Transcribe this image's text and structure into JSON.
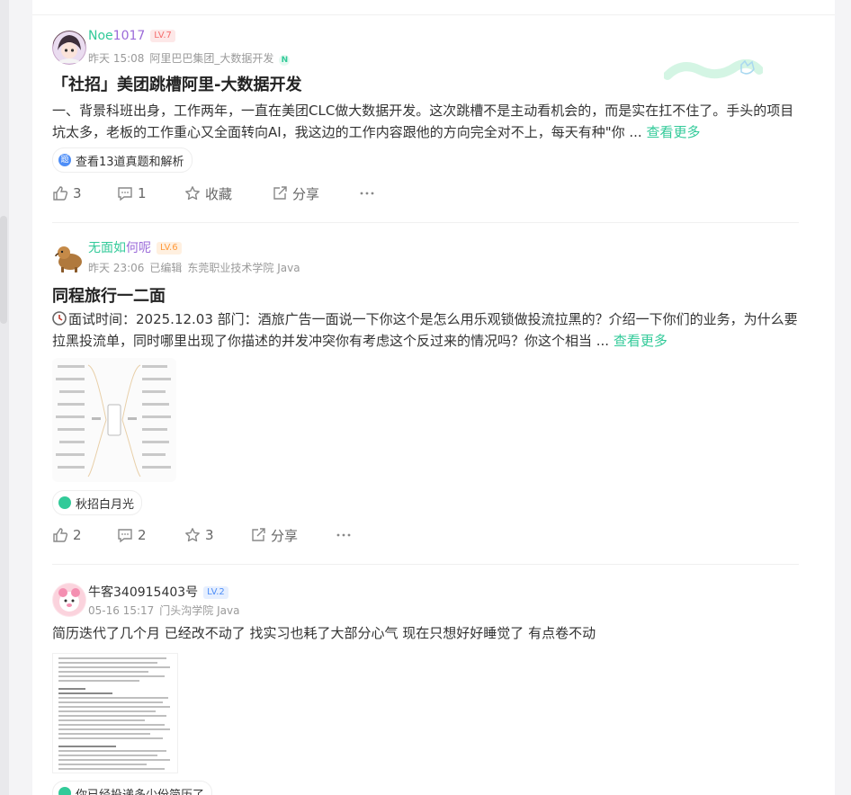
{
  "posts": [
    {
      "author": {
        "name_a": "Noe",
        "name_b": "1017",
        "level": "LV.7"
      },
      "meta": {
        "time": "昨天 15:08",
        "org": "阿里巴巴集团_大数据开发",
        "badge": "N"
      },
      "title": "「社招」美团跳槽阿里-大数据开发",
      "body": "一、背景科班出身，工作两年，一直在美团CLC做大数据开发。这次跳槽不是主动看机会的，而是实在扛不住了。手头的项目坑太多，老板的工作重心又全面转向AI，我这边的工作内容跟他的方向完全对不上，每天有种\"你 ...",
      "more": "查看更多",
      "tag": "查看13道真题和解析",
      "tag_icon": "题",
      "likes": "3",
      "comments": "1",
      "favorite": "收藏",
      "share": "分享"
    },
    {
      "author": {
        "name_a": "无面如",
        "name_b": "何呢",
        "level": "LV.6"
      },
      "meta": {
        "time": "昨天 23:06",
        "edited": "已编辑",
        "org": "东莞职业技术学院 Java"
      },
      "title": "同程旅行一二面",
      "body": "面试时间：2025.12.03 部门：酒旅广告一面说一下你这个是怎么用乐观锁做投流拉黑的？介绍一下你们的业务，为什么要拉黑投流单，同时哪里出现了你描述的并发冲突你有考虑这个反过来的情况吗？你这个相当 ...",
      "more": "查看更多",
      "tag": "秋招白月光",
      "likes": "2",
      "comments": "2",
      "favorite": "3",
      "share": "分享"
    },
    {
      "author": {
        "name": "牛客340915403号",
        "level": "LV.2"
      },
      "meta": {
        "time": "05-16 15:17",
        "org": "门头沟学院 Java"
      },
      "body": "简历迭代了几个月 已经改不动了 找实习也耗了大部分心气 现在只想好好睡觉了 有点卷不动",
      "tag": "你已经投递多少份简历了"
    }
  ],
  "colors": {
    "accent": "#32ca99",
    "lv_red": "#f56c6c",
    "lv_orange": "#ff9a3c",
    "lv_blue": "#4e8ef7"
  },
  "icons": [
    "like-icon",
    "comment-icon",
    "star-icon",
    "share-icon",
    "more-icon",
    "clock-icon",
    "building-icon"
  ]
}
